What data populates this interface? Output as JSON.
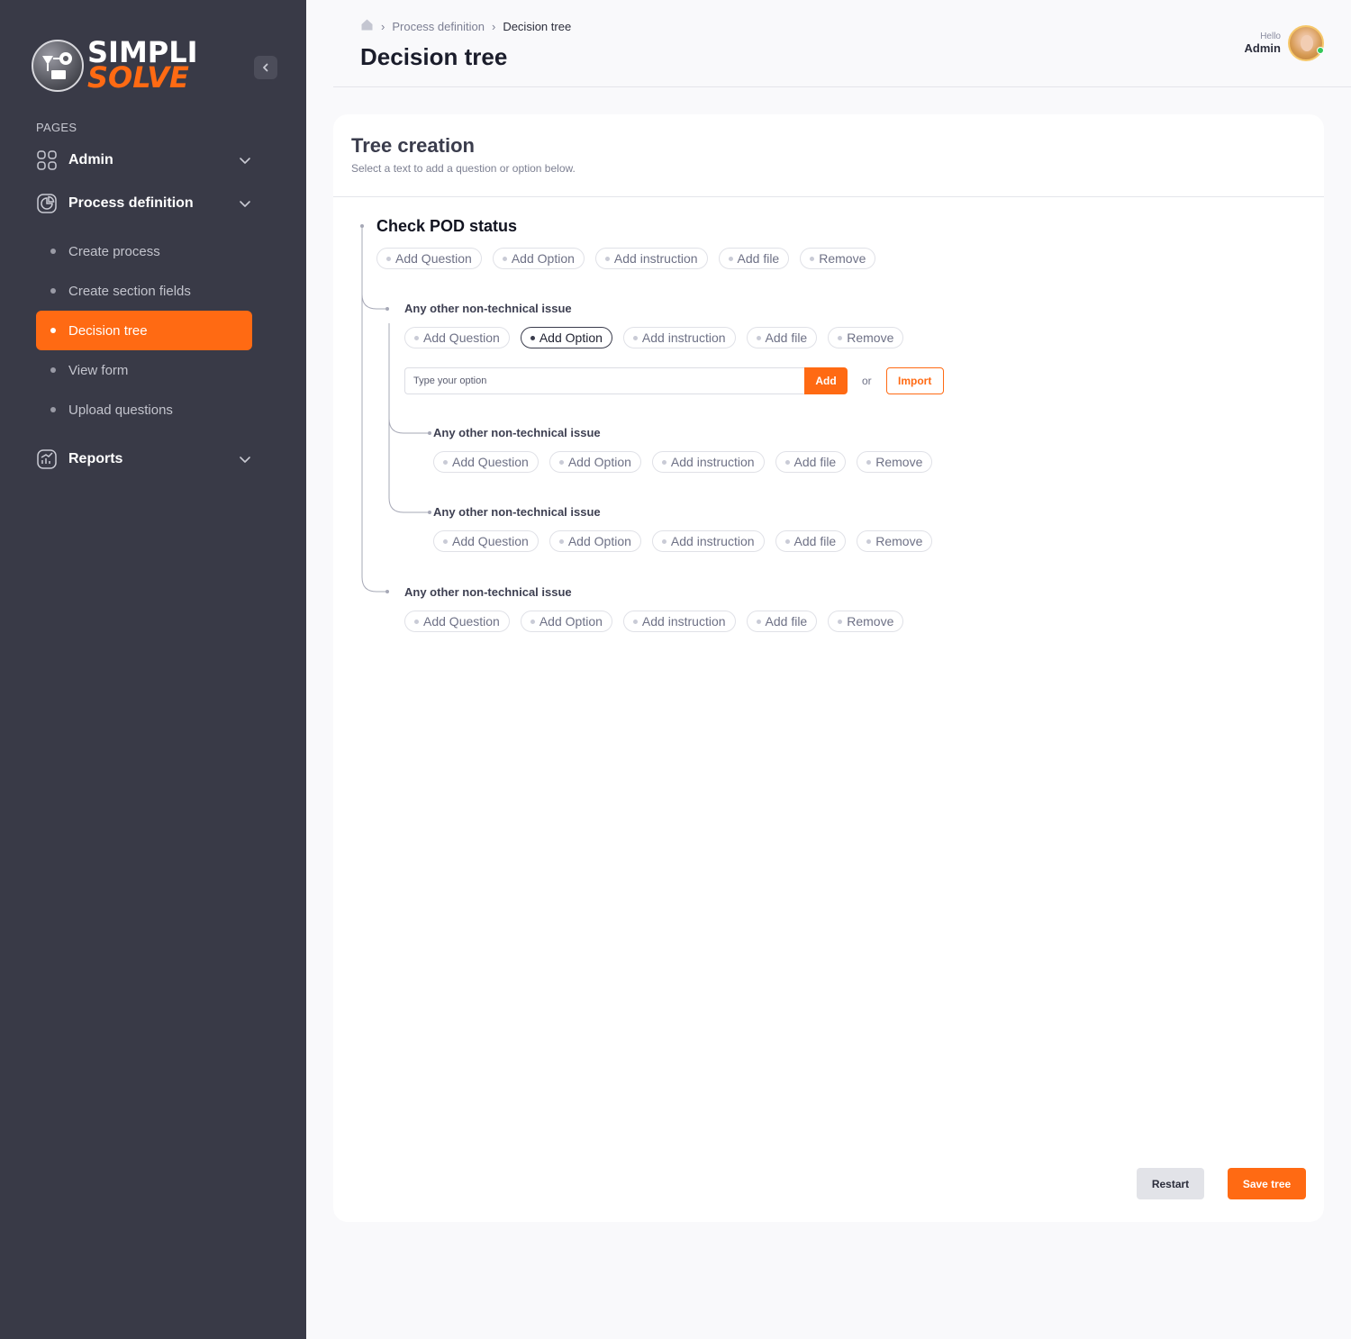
{
  "brand": {
    "line1": "SIMPLI",
    "line2": "SOLVE",
    "accent": "#ff6a13",
    "sidebar_bg": "#393a47"
  },
  "sidebar": {
    "section_label": "PAGES",
    "groups": [
      {
        "label": "Admin",
        "icon": "grid-icon"
      },
      {
        "label": "Process definition",
        "icon": "pie-chart-icon"
      },
      {
        "label": "Reports",
        "icon": "bar-chart-icon"
      }
    ],
    "sub_items": [
      {
        "label": "Create process"
      },
      {
        "label": "Create section fields"
      },
      {
        "label": "Decision tree",
        "active": true
      },
      {
        "label": "View form"
      },
      {
        "label": "Upload questions"
      }
    ]
  },
  "header": {
    "breadcrumb": [
      "Process definition",
      "Decision tree"
    ],
    "title": "Decision tree",
    "greeting": "Hello",
    "user_name": "Admin"
  },
  "card": {
    "title": "Tree creation",
    "subtitle": "Select a text to add a question or option below."
  },
  "tree": {
    "root": {
      "title": "Check POD status",
      "actions": [
        "Add Question",
        "Add Option",
        "Add instruction",
        "Add file",
        "Remove"
      ]
    },
    "nodes": [
      {
        "label": "Any other non-technical issue",
        "actions": [
          "Add Question",
          "Add Option",
          "Add instruction",
          "Add file",
          "Remove"
        ],
        "active_action": "Add Option"
      },
      {
        "label": "Any other non-technical issue",
        "actions": [
          "Add Question",
          "Add Option",
          "Add instruction",
          "Add file",
          "Remove"
        ]
      },
      {
        "label": "Any other non-technical issue",
        "actions": [
          "Add Question",
          "Add Option",
          "Add instruction",
          "Add file",
          "Remove"
        ]
      },
      {
        "label": "Any other non-technical issue",
        "actions": [
          "Add Question",
          "Add Option",
          "Add instruction",
          "Add file",
          "Remove"
        ]
      }
    ],
    "option_input": {
      "placeholder": "Type your option",
      "add_label": "Add",
      "or_label": "or",
      "import_label": "Import"
    }
  },
  "footer": {
    "restart_label": "Restart",
    "save_label": "Save tree"
  }
}
